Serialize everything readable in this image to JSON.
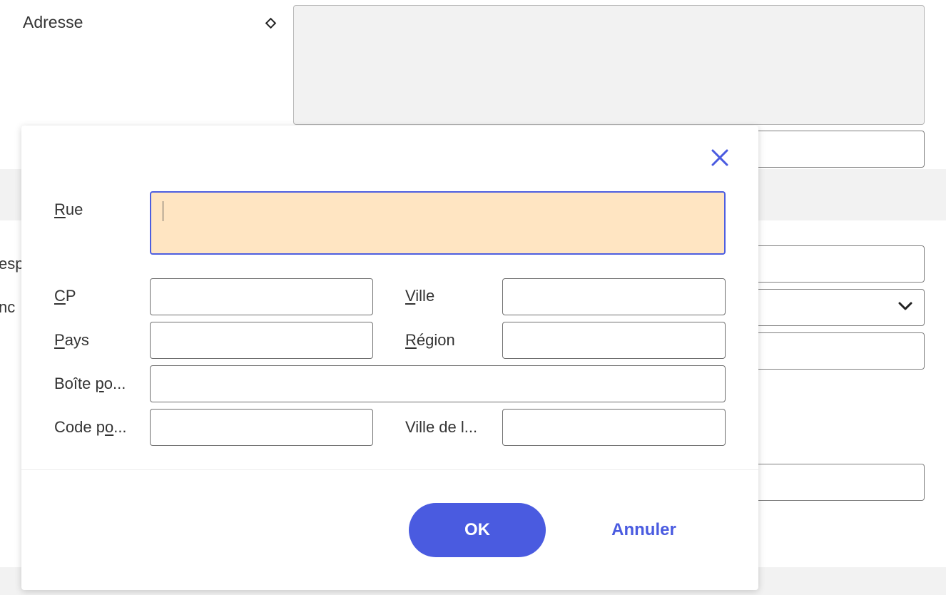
{
  "background_form": {
    "address_label": "Adresse",
    "partial_label_1": "esp",
    "partial_label_2": "nc"
  },
  "dialog": {
    "street": {
      "label": "Rue",
      "mnemonic_index": 0,
      "value": ""
    },
    "zip": {
      "label": "CP",
      "mnemonic_index": 0,
      "value": ""
    },
    "city": {
      "label": "Ville",
      "mnemonic_index": 0,
      "value": ""
    },
    "country": {
      "label": "Pays",
      "mnemonic_index": 0,
      "value": ""
    },
    "region": {
      "label": "Région",
      "mnemonic_index": 0,
      "value": ""
    },
    "po_box": {
      "label": "Boîte po...",
      "mnemonic_index": 6,
      "value": ""
    },
    "postal_code": {
      "label": "Code po...",
      "mnemonic_index": 6,
      "value": ""
    },
    "po_box_city": {
      "label": "Ville de l...",
      "value": ""
    },
    "ok_label": "OK",
    "cancel_label": "Annuler"
  },
  "colors": {
    "accent": "#4a5be0",
    "active_field_bg": "#ffe5c2",
    "band_bg": "#f2f2f2"
  },
  "icons": {
    "close": "close-icon",
    "diamond": "diamond-icon",
    "dropdown": "chevron-down-icon"
  }
}
